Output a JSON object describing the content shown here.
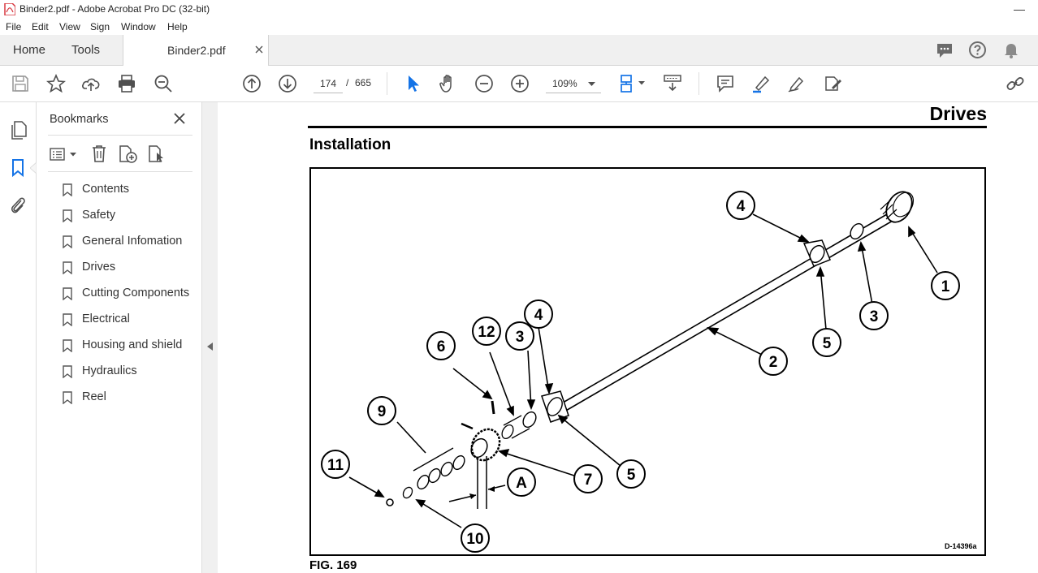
{
  "window": {
    "title": "Binder2.pdf - Adobe Acrobat Pro DC (32-bit)",
    "minimize": "—"
  },
  "menu": [
    "File",
    "Edit",
    "View",
    "Sign",
    "Window",
    "Help"
  ],
  "tabs": {
    "home": "Home",
    "tools": "Tools",
    "document": "Binder2.pdf"
  },
  "toolbar": {
    "current_page": "174",
    "page_separator": "/",
    "total_pages": "665",
    "zoom": "109%"
  },
  "bookmarks_panel": {
    "title": "Bookmarks",
    "items": [
      "Contents",
      "Safety",
      "General Infomation",
      "Drives",
      "Cutting Components",
      "Electrical",
      "Housing and shield",
      "Hydraulics",
      "Reel"
    ]
  },
  "document": {
    "section_title": "Drives",
    "heading": "Installation",
    "figure_caption": "FIG. 169",
    "drawing_id": "D-14396a",
    "callouts": [
      "1",
      "2",
      "3",
      "4",
      "5",
      "3",
      "4",
      "5",
      "7",
      "12",
      "6",
      "9",
      "11",
      "10",
      "A"
    ]
  },
  "colors": {
    "accent_blue": "#1473e6",
    "pdf_red": "#d7373f",
    "icon_gray": "#505050"
  }
}
